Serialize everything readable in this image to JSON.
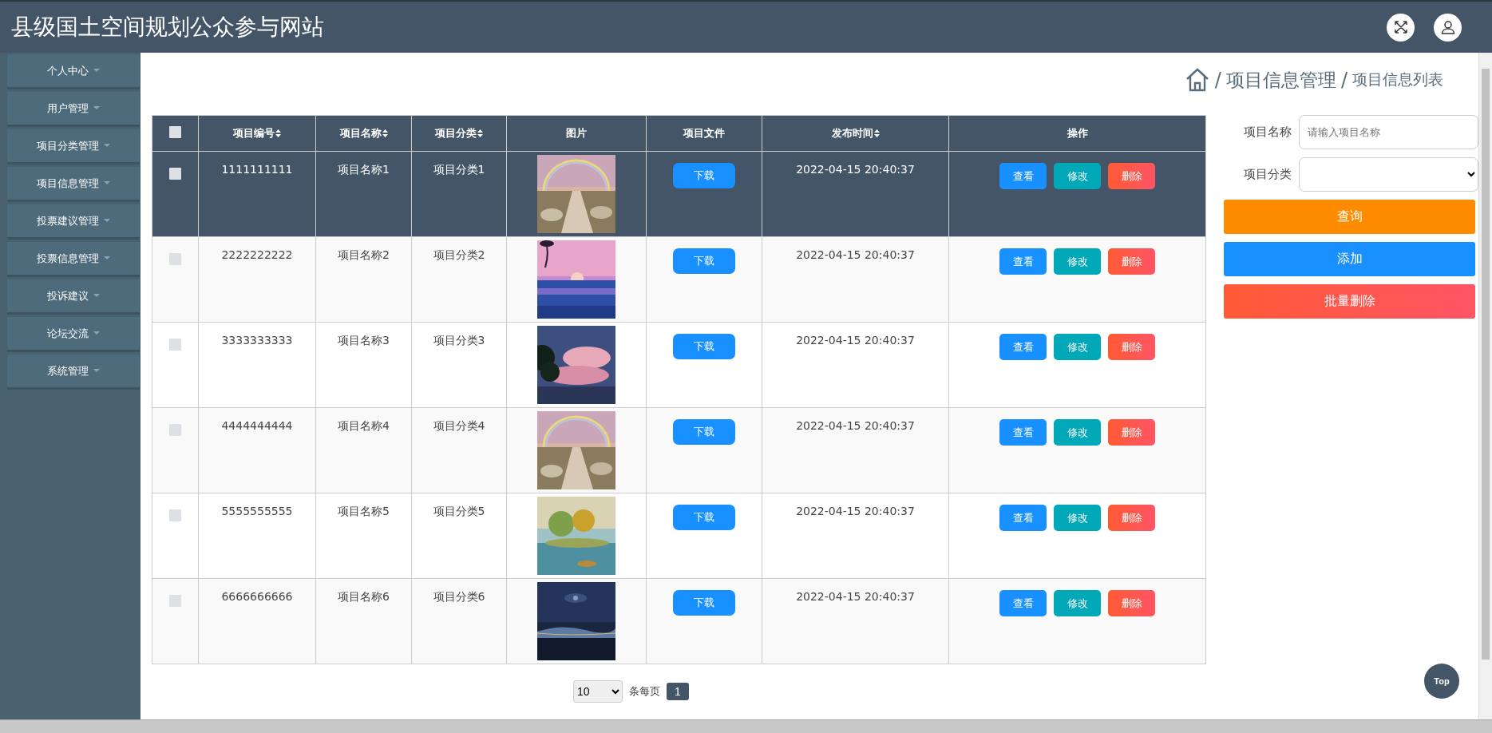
{
  "header": {
    "title": "县级国土空间规划公众参与网站"
  },
  "sidebar": {
    "items": [
      {
        "label": "个人中心"
      },
      {
        "label": "用户管理"
      },
      {
        "label": "项目分类管理"
      },
      {
        "label": "项目信息管理"
      },
      {
        "label": "投票建议管理"
      },
      {
        "label": "投票信息管理"
      },
      {
        "label": "投诉建议"
      },
      {
        "label": "论坛交流"
      },
      {
        "label": "系统管理"
      }
    ]
  },
  "breadcrumb": [
    {
      "separator": "/",
      "label": "项目信息管理"
    },
    {
      "separator": "/",
      "label": "项目信息列表"
    }
  ],
  "table": {
    "select_all": {
      "checked": false
    },
    "columns": [
      {
        "label": "项目编号",
        "sortable": true
      },
      {
        "label": "项目名称",
        "sortable": true
      },
      {
        "label": "项目分类",
        "sortable": true
      },
      {
        "label": "图片",
        "sortable": false
      },
      {
        "label": "项目文件",
        "sortable": false
      },
      {
        "label": "发布时间",
        "sortable": true
      },
      {
        "label": "操作",
        "sortable": false
      }
    ],
    "rows": [
      {
        "selected": true,
        "checked": false,
        "code": "1111111111",
        "name": "项目名称1",
        "category": "项目分类1",
        "file_button": "下载",
        "time": "2022-04-15 20:40:37",
        "actions": [
          "查看",
          "修改",
          "删除"
        ]
      },
      {
        "selected": false,
        "checked": false,
        "code": "2222222222",
        "name": "项目名称2",
        "category": "项目分类2",
        "file_button": "下载",
        "time": "2022-04-15 20:40:37",
        "actions": [
          "查看",
          "修改",
          "删除"
        ]
      },
      {
        "selected": false,
        "checked": false,
        "code": "3333333333",
        "name": "项目名称3",
        "category": "项目分类3",
        "file_button": "下载",
        "time": "2022-04-15 20:40:37",
        "actions": [
          "查看",
          "修改",
          "删除"
        ]
      },
      {
        "selected": false,
        "checked": false,
        "code": "4444444444",
        "name": "项目名称4",
        "category": "项目分类4",
        "file_button": "下载",
        "time": "2022-04-15 20:40:37",
        "actions": [
          "查看",
          "修改",
          "删除"
        ]
      },
      {
        "selected": false,
        "checked": false,
        "code": "5555555555",
        "name": "项目名称5",
        "category": "项目分类5",
        "file_button": "下载",
        "time": "2022-04-15 20:40:37",
        "actions": [
          "查看",
          "修改",
          "删除"
        ]
      },
      {
        "selected": false,
        "checked": false,
        "code": "6666666666",
        "name": "项目名称6",
        "category": "项目分类6",
        "file_button": "下载",
        "time": "2022-04-15 20:40:37",
        "actions": [
          "查看",
          "修改",
          "删除"
        ]
      }
    ]
  },
  "pagination": {
    "page_size": "10",
    "per_page_label": "条每页",
    "pages": [
      {
        "label": "1",
        "selected": true
      }
    ]
  },
  "search": {
    "name_label": "项目名称",
    "name_placeholder": "请输入项目名称",
    "category_label": "项目分类",
    "buttons": [
      "查询",
      "添加",
      "批量删除"
    ]
  },
  "top_button": "Top"
}
